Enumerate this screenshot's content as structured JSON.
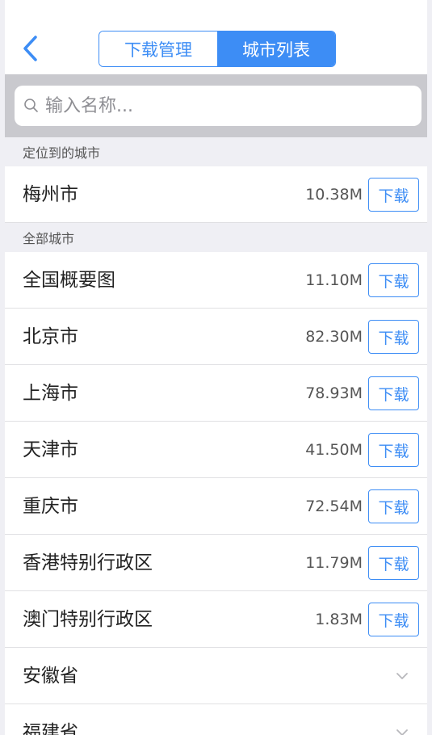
{
  "nav": {
    "tabs": [
      {
        "label": "下载管理",
        "active": false
      },
      {
        "label": "城市列表",
        "active": true
      }
    ]
  },
  "search": {
    "placeholder": "输入名称..."
  },
  "sections": {
    "located_header": "定位到的城市",
    "all_header": "全部城市"
  },
  "located_city": {
    "name": "梅州市",
    "size": "10.38M",
    "action": "下载"
  },
  "cities": [
    {
      "name": "全国概要图",
      "size": "11.10M",
      "action": "下载"
    },
    {
      "name": "北京市",
      "size": "82.30M",
      "action": "下载"
    },
    {
      "name": "上海市",
      "size": "78.93M",
      "action": "下载"
    },
    {
      "name": "天津市",
      "size": "41.50M",
      "action": "下载"
    },
    {
      "name": "重庆市",
      "size": "72.54M",
      "action": "下载"
    },
    {
      "name": "香港特别行政区",
      "size": "11.79M",
      "action": "下载"
    },
    {
      "name": "澳门特别行政区",
      "size": "1.83M",
      "action": "下载"
    }
  ],
  "provinces": [
    {
      "name": "安徽省"
    },
    {
      "name": "福建省"
    }
  ],
  "colors": {
    "accent": "#3d8df5",
    "search_bg": "#c9c9ce",
    "section_bg": "#efeff4"
  }
}
